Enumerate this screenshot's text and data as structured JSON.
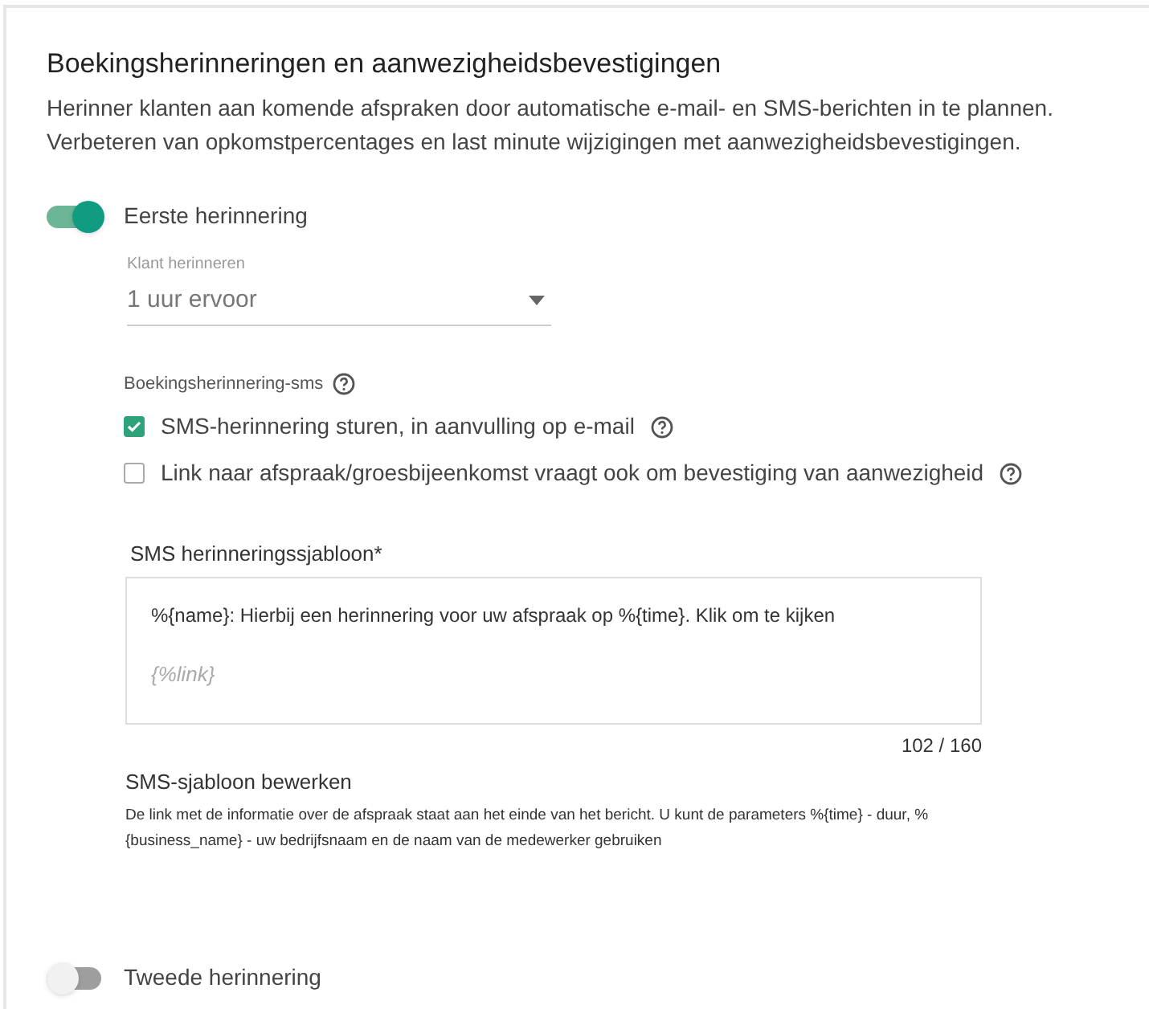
{
  "title": "Boekingsherinneringen en aanwezigheidsbevestigingen",
  "description_lines": [
    "Herinner klanten aan komende afspraken door automatische e-mail- en SMS-berichten in te plannen.",
    "Verbeteren van opkomstpercentages en last minute wijzigingen met aanwezigheidsbevestigingen."
  ],
  "first_reminder": {
    "label": "Eerste herinnering",
    "on": true
  },
  "remind_select": {
    "label": "Klant herinneren",
    "value": "1 uur ervoor"
  },
  "sms_section": {
    "label": "Boekingsherinnering-sms",
    "options": [
      {
        "label": "SMS-herinnering sturen, in aanvulling op e-mail",
        "checked": true
      },
      {
        "label": "Link naar afspraak/groesbijeenkomst vraagt ook om bevestiging van aanwezigheid",
        "checked": false
      }
    ]
  },
  "template": {
    "label": "SMS herinneringssjabloon*",
    "value": "%{name}: Hierbij een herinnering voor uw afspraak op %{time}. Klik om te kijken",
    "link": "{%link}",
    "counter": "102 / 160"
  },
  "edit_help": {
    "title": "SMS-sjabloon bewerken",
    "text": "De link met de informatie over de afspraak staat aan het einde van het bericht. U kunt de parameters %{time} - duur, %{business_name} - uw bedrijfsnaam en de naam van de medewerker gebruiken"
  },
  "second_reminder": {
    "label": "Tweede herinnering",
    "on": false
  }
}
